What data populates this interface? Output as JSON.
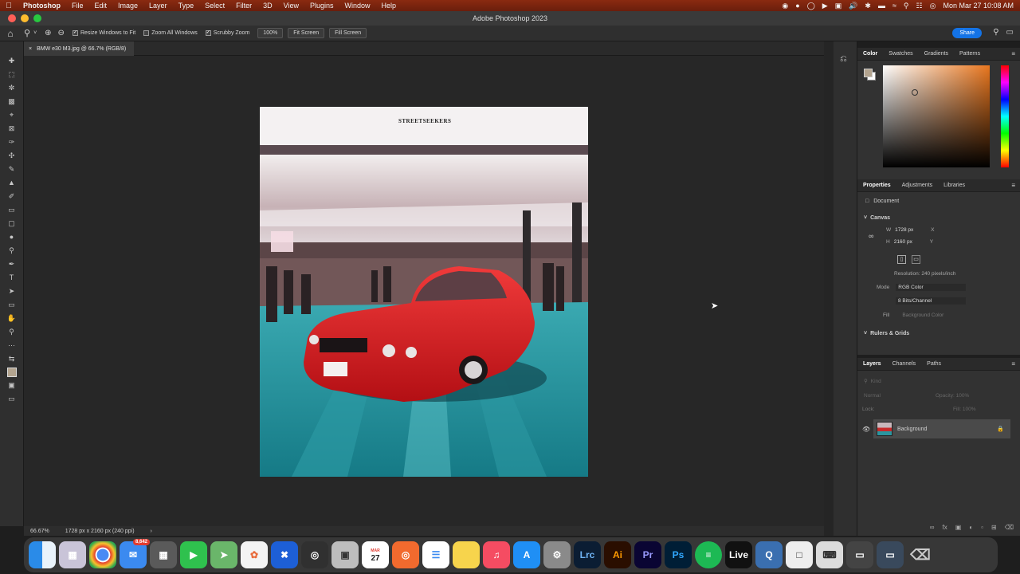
{
  "menubar": {
    "app": "Photoshop",
    "items": [
      "File",
      "Edit",
      "Image",
      "Layer",
      "Type",
      "Select",
      "Filter",
      "3D",
      "View",
      "Plugins",
      "Window",
      "Help"
    ],
    "clock": "Mon Mar 27  10:08 AM"
  },
  "window_title": "Adobe Photoshop 2023",
  "options": {
    "resize_windows": "Resize Windows to Fit",
    "zoom_all": "Zoom All Windows",
    "scrubby": "Scrubby Zoom",
    "zoom_value": "100%",
    "fit_screen": "Fit Screen",
    "fill_screen": "Fill Screen",
    "share": "Share"
  },
  "document": {
    "tab": "BMW e30 M3.jpg @ 66.7% (RGB/8)",
    "watermark": "STREETSEEKERS"
  },
  "status": {
    "zoom": "66.67%",
    "info": "1728 px x 2160 px (240 ppi)"
  },
  "color_panel": {
    "tabs": [
      "Color",
      "Swatches",
      "Gradients",
      "Patterns"
    ],
    "fg_color": "#b3a48f",
    "hue_color": "#e8761e"
  },
  "properties": {
    "tabs": [
      "Properties",
      "Adjustments",
      "Libraries"
    ],
    "type": "Document",
    "canvas_label": "Canvas",
    "w_label": "W",
    "w_value": "1728 px",
    "h_label": "H",
    "h_value": "2160 px",
    "x_label": "X",
    "y_label": "Y",
    "resolution": "Resolution: 240 pixels/inch",
    "mode_label": "Mode",
    "mode_value": "RGB Color",
    "bits_value": "8 Bits/Channel",
    "fill_label": "Fill",
    "fill_value": "Background Color",
    "rulers": "Rulers & Grids"
  },
  "layers": {
    "tabs": [
      "Layers",
      "Channels",
      "Paths"
    ],
    "kind": "Kind",
    "blend": "Normal",
    "opacity": "Opacity: 100%",
    "lock": "Lock:",
    "fill": "Fill: 100%",
    "layer_name": "Background"
  },
  "dock": {
    "mail_badge": "8,642",
    "calendar_month": "MAR",
    "calendar_day": "27",
    "apps": [
      "Finder",
      "Launchpad",
      "Chrome",
      "Mail",
      "Calculator",
      "FaceTime",
      "Maps",
      "Photos",
      "Migration",
      "Screen",
      "Preview",
      "Calendar",
      "Screen Recorder",
      "Reminders",
      "Notes",
      "Music",
      "App Store",
      "System Settings",
      "Lrc",
      "Ai",
      "Pr",
      "Ps",
      "Spotify",
      "Live",
      "QuickTime",
      "File",
      "Keyboard",
      "Finder Window",
      "Desktop",
      "Trash"
    ]
  }
}
